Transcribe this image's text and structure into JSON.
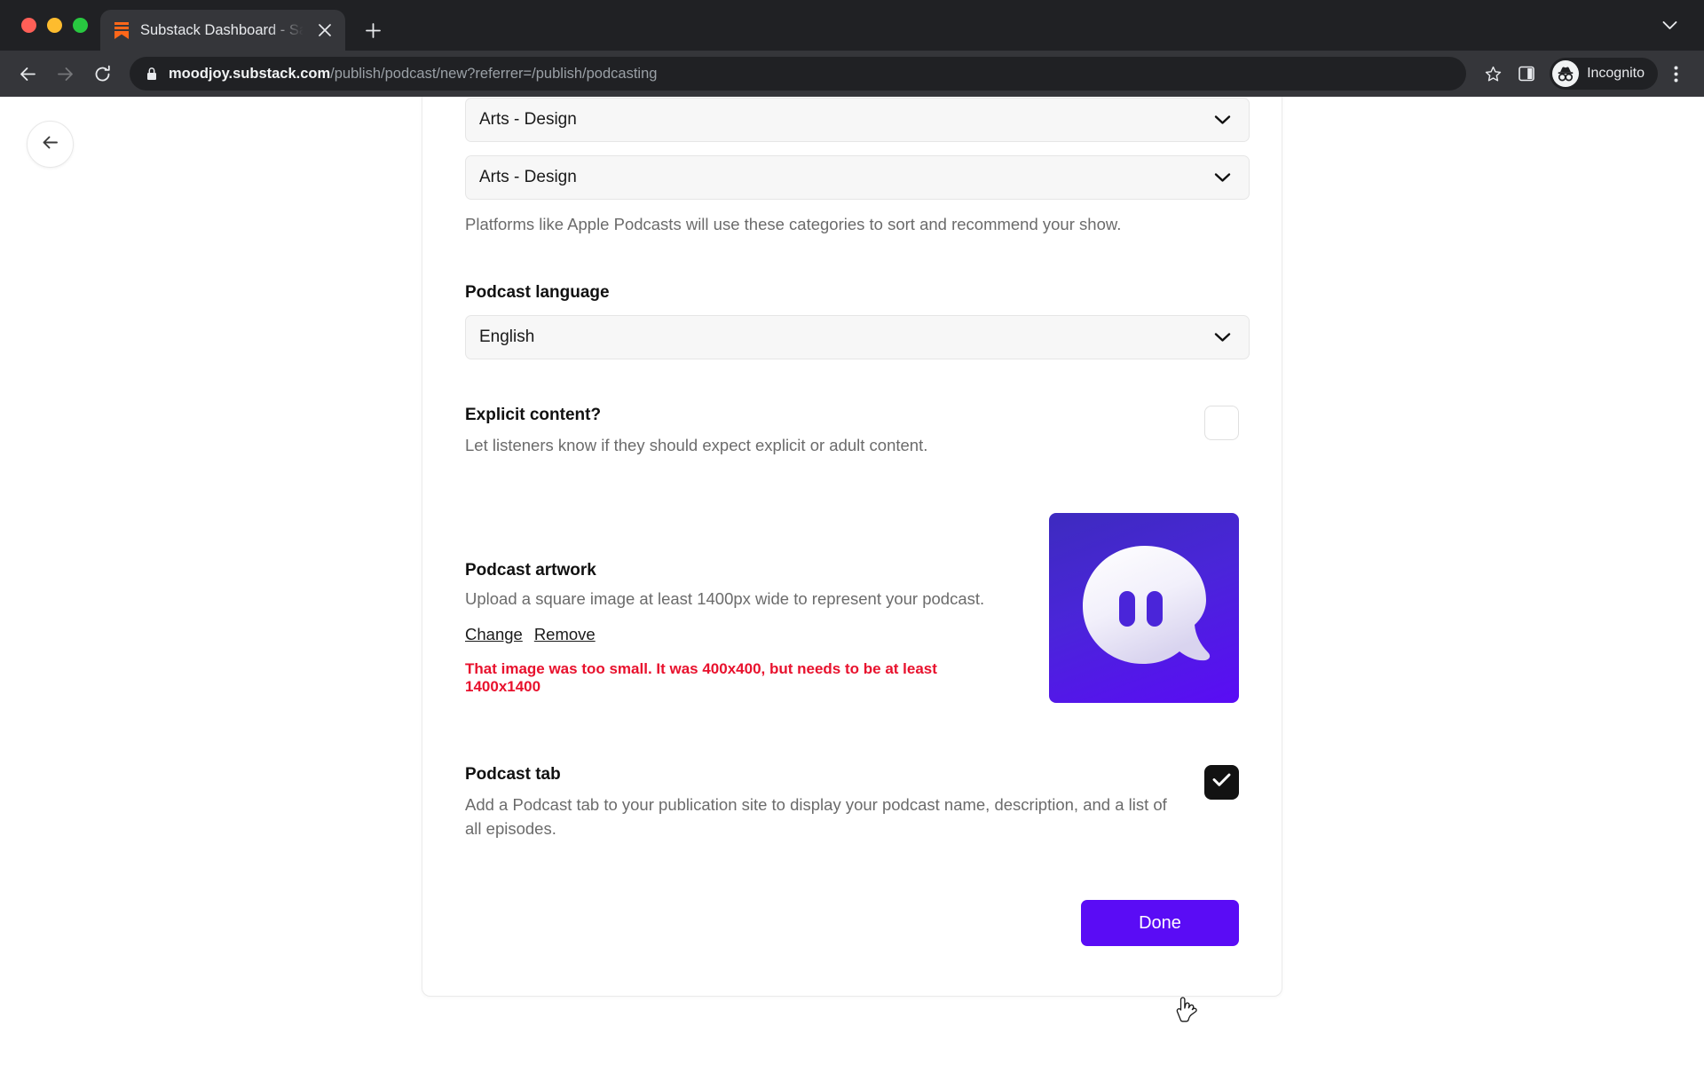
{
  "browser": {
    "tab": {
      "title": "Substack Dashboard - Sarah's",
      "favicon": "substack-icon",
      "close_icon": "close-icon"
    },
    "new_tab_icon": "plus-icon",
    "window_chevron_icon": "chevron-down-icon",
    "nav": {
      "back_icon": "arrow-left-icon",
      "forward_icon": "arrow-right-icon",
      "reload_icon": "reload-icon"
    },
    "omnibox": {
      "lock_icon": "lock-icon",
      "url_host": "moodjoy.substack.com",
      "url_path": "/publish/podcast/new?referrer=/publish/podcasting",
      "bookmark_icon": "star-icon",
      "side_panel_icon": "side-panel-icon"
    },
    "profile": {
      "label": "Incognito",
      "icon": "incognito-icon"
    },
    "menu_icon": "three-dot-menu-icon"
  },
  "page": {
    "back_button_icon": "arrow-left-icon",
    "categories": {
      "primary_value": "Arts - Design",
      "secondary_value": "Arts - Design",
      "chevron_icon": "chevron-down-icon",
      "help_text": "Platforms like Apple Podcasts will use these categories to sort and recommend your show."
    },
    "language": {
      "label": "Podcast language",
      "value": "English",
      "chevron_icon": "chevron-down-icon"
    },
    "explicit": {
      "title": "Explicit content?",
      "description": "Let listeners know if they should expect explicit or adult content.",
      "checked": false
    },
    "artwork": {
      "title": "Podcast artwork",
      "description": "Upload a square image at least 1400px wide to represent your podcast.",
      "change_label": "Change",
      "remove_label": "Remove",
      "error": "That image was too small. It was 400x400, but needs to be at least 1400x1400",
      "error_color": "#e8112d",
      "image_alt": "ghost-mascot-artwork"
    },
    "podcast_tab": {
      "title": "Podcast tab",
      "description": "Add a Podcast tab to your publication site to display your podcast name, description, and a list of all episodes.",
      "checked": true,
      "check_icon": "checkmark-icon"
    },
    "done_button": {
      "label": "Done",
      "color": "#5a0cf5"
    },
    "cursor_icon": "pointer-hand-cursor"
  }
}
